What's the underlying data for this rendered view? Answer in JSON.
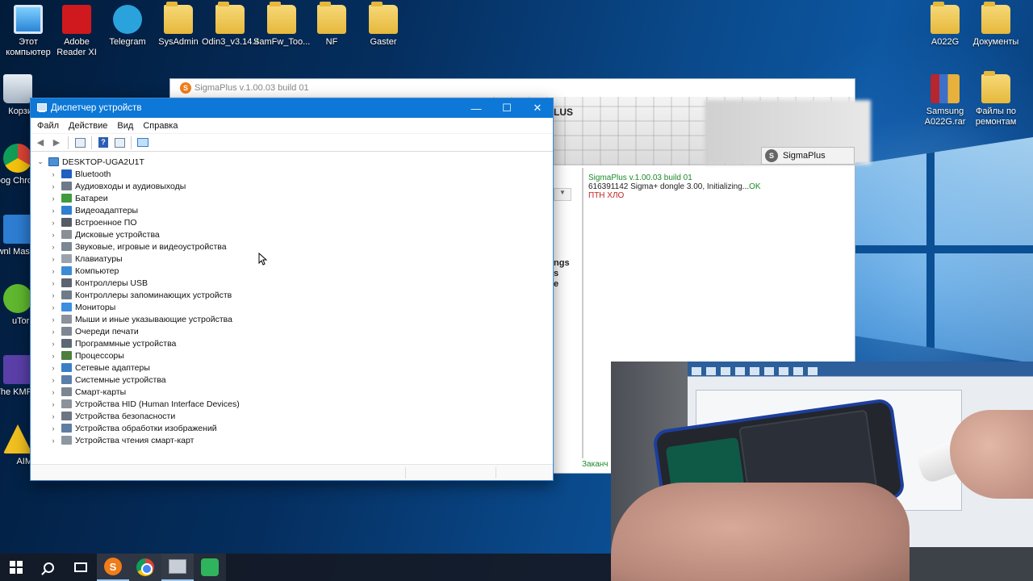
{
  "desktop": {
    "icons_left": [
      {
        "label": "Этот компьютер",
        "type": "pc"
      },
      {
        "label": "Adobe Reader XI",
        "type": "pdf"
      },
      {
        "label": "Telegram",
        "type": "tg"
      },
      {
        "label": "SysAdmin",
        "type": "folder"
      },
      {
        "label": "Odin3_v3.14.4",
        "type": "folder"
      },
      {
        "label": "SamFw_Too...",
        "type": "folder"
      },
      {
        "label": "NF",
        "type": "folder"
      },
      {
        "label": "Gaster",
        "type": "folder"
      }
    ],
    "icons_left_column": [
      {
        "label": "Корзи",
        "type": "trash"
      },
      {
        "label": "Goog Chro",
        "type": "chrome"
      },
      {
        "label": "Downl Mast",
        "type": "download"
      },
      {
        "label": "uTorr",
        "type": "utorrent"
      },
      {
        "label": "The KMP",
        "type": "kmp"
      },
      {
        "label": "AIM",
        "type": "aim"
      }
    ],
    "icons_right": [
      {
        "label": "A022G",
        "type": "folder"
      },
      {
        "label": "Документы",
        "type": "folder"
      },
      {
        "label": "Samsung A022G.rar",
        "type": "zip"
      },
      {
        "label": "Файлы по ремонтам",
        "type": "folder"
      }
    ]
  },
  "sigma": {
    "title": "SigmaPlus v.1.00.03 build 01",
    "brand_partial": "LUS",
    "tab_label": "SigmaPlus",
    "partial_text": [
      "ngs",
      "s",
      "e"
    ],
    "log": {
      "line1": "SigmaPlus v.1.00.03 build 01",
      "line2_prefix": "616391142 Sigma+ dongle 3.00, Initializing...",
      "line2_ok": "OK",
      "line3": "ПТН ХЛО"
    },
    "footer_partial": "Заканч"
  },
  "devmgr": {
    "title": "Диспетчер устройств",
    "menu": [
      "Файл",
      "Действие",
      "Вид",
      "Справка"
    ],
    "root": "DESKTOP-UGA2U1T",
    "categories": [
      {
        "label": "Bluetooth",
        "color": "#1f5fbf"
      },
      {
        "label": "Аудиовходы и аудиовыходы",
        "color": "#6d7a88"
      },
      {
        "label": "Батареи",
        "color": "#3f9b3f"
      },
      {
        "label": "Видеоадаптеры",
        "color": "#2f7fd0"
      },
      {
        "label": "Встроенное ПО",
        "color": "#555c66"
      },
      {
        "label": "Дисковые устройства",
        "color": "#8a8f96"
      },
      {
        "label": "Звуковые, игровые и видеоустройства",
        "color": "#7a8794"
      },
      {
        "label": "Клавиатуры",
        "color": "#9aa3ad"
      },
      {
        "label": "Компьютер",
        "color": "#3d8ad8"
      },
      {
        "label": "Контроллеры USB",
        "color": "#5b6470"
      },
      {
        "label": "Контроллеры запоминающих устройств",
        "color": "#6f7b88"
      },
      {
        "label": "Мониторы",
        "color": "#3b8ee0"
      },
      {
        "label": "Мыши и иные указывающие устройства",
        "color": "#8b929b"
      },
      {
        "label": "Очереди печати",
        "color": "#7d8894"
      },
      {
        "label": "Программные устройства",
        "color": "#5d6875"
      },
      {
        "label": "Процессоры",
        "color": "#4f7f3f"
      },
      {
        "label": "Сетевые адаптеры",
        "color": "#3a7fc5"
      },
      {
        "label": "Системные устройства",
        "color": "#5a7fa8"
      },
      {
        "label": "Смарт-карты",
        "color": "#7b8692"
      },
      {
        "label": "Устройства HID (Human Interface Devices)",
        "color": "#8a929b"
      },
      {
        "label": "Устройства безопасности",
        "color": "#6c7682"
      },
      {
        "label": "Устройства обработки изображений",
        "color": "#5f7ea3"
      },
      {
        "label": "Устройства чтения смарт-карт",
        "color": "#8d97a2"
      }
    ]
  },
  "taskbar": {
    "items": [
      "start",
      "search",
      "task-view",
      "sigmaplus",
      "chrome",
      "device-manager",
      "green-app"
    ],
    "active": "device-manager"
  }
}
